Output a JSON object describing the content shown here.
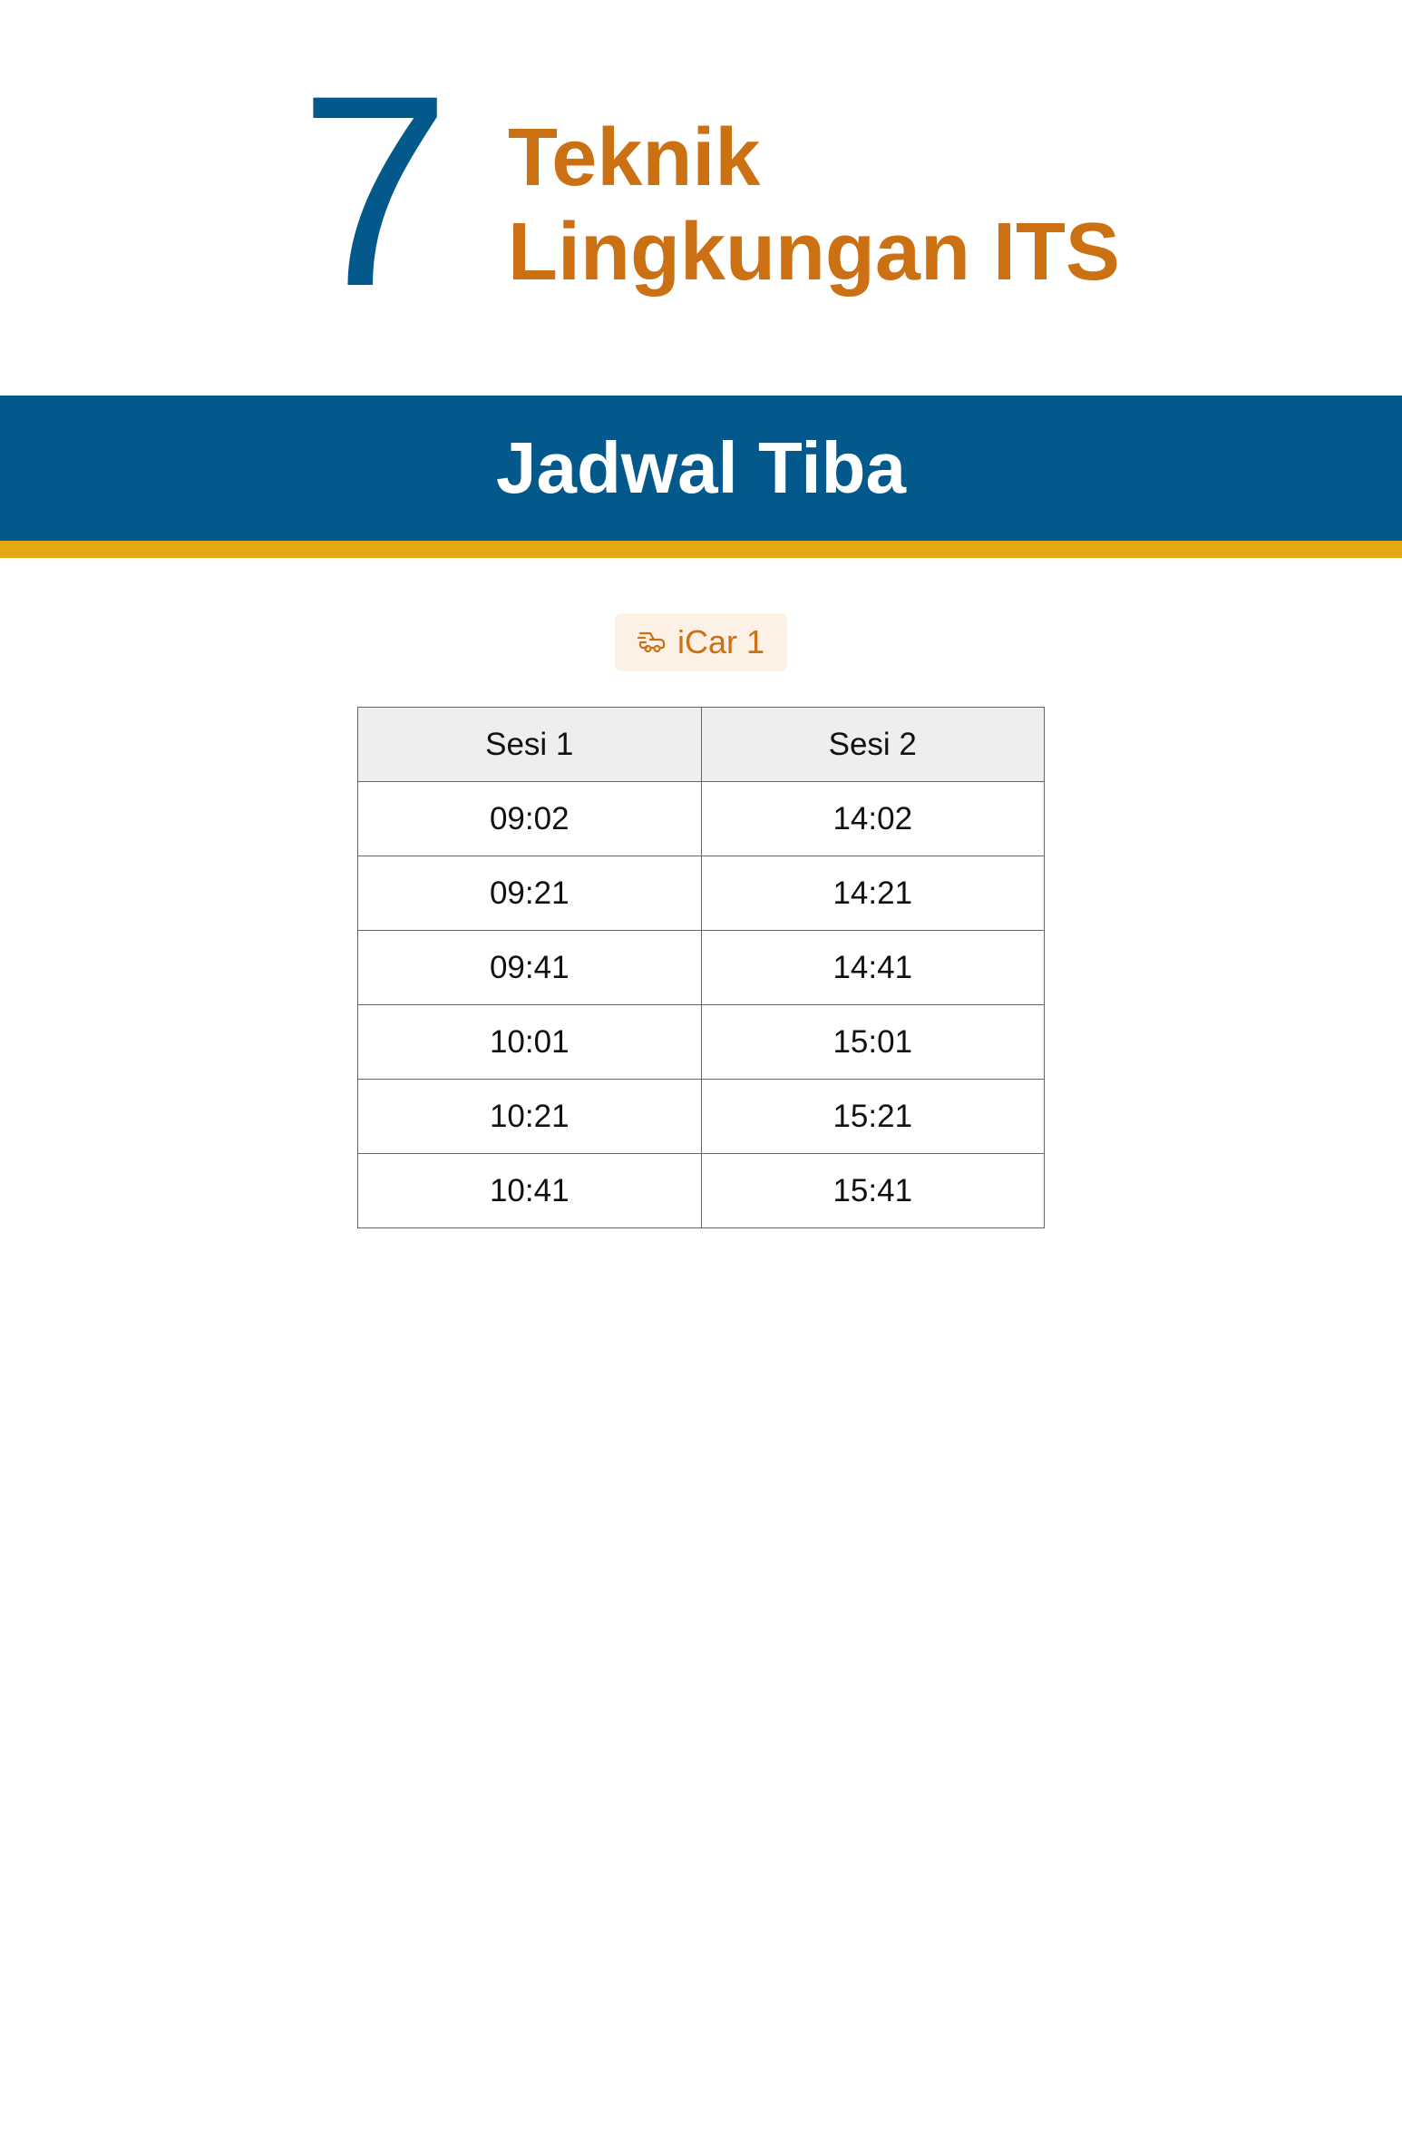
{
  "stop": {
    "number": "7",
    "name_line1": "Teknik",
    "name_line2": "Lingkungan ITS"
  },
  "banner": {
    "title": "Jadwal Tiba"
  },
  "vehicle": {
    "icon": "car-icon",
    "label": "iCar 1"
  },
  "schedule": {
    "headers": [
      "Sesi 1",
      "Sesi 2"
    ],
    "rows": [
      [
        "09:02",
        "14:02"
      ],
      [
        "09:21",
        "14:21"
      ],
      [
        "09:41",
        "14:41"
      ],
      [
        "10:01",
        "15:01"
      ],
      [
        "10:21",
        "15:21"
      ],
      [
        "10:41",
        "15:41"
      ]
    ]
  },
  "colors": {
    "primary_blue": "#04598c",
    "accent_orange": "#cc7014",
    "stripe_yellow": "#e2a912",
    "badge_bg": "#fcf1e4",
    "header_bg": "#edeef0"
  }
}
